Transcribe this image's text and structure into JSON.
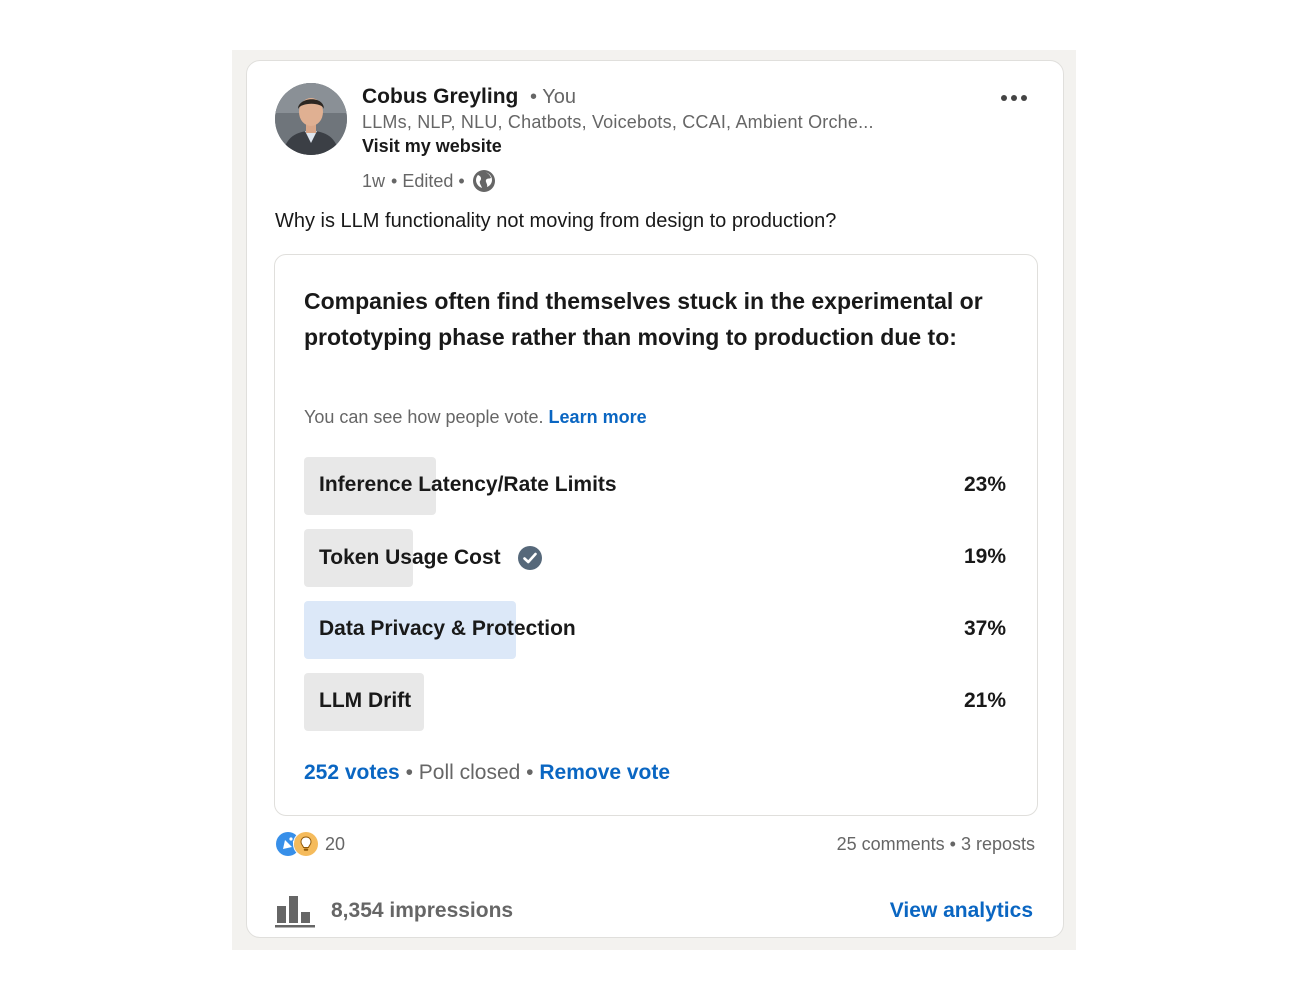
{
  "author": {
    "name": "Cobus Greyling",
    "degree": "• You",
    "headline": "LLMs, NLP, NLU, Chatbots, Voicebots, CCAI, Ambient Orche...",
    "website_label": "Visit my website",
    "time": "1w",
    "edited": "• Edited •",
    "visibility_icon": "globe-icon"
  },
  "menu_icon": "more-horizontal-icon",
  "post": {
    "text": "Why is LLM functionality not moving from design to production?"
  },
  "poll": {
    "question": "Companies often find themselves stuck in the experimental or prototyping phase rather than moving to production due to:",
    "note": "You can see how people vote.",
    "learn_more": "Learn more",
    "options": [
      {
        "label": "Inference Latency/Rate Limits",
        "percent_label": "23%",
        "percent": 23,
        "selected": false
      },
      {
        "label": "Token Usage Cost",
        "percent_label": "19%",
        "percent": 19,
        "selected": false,
        "checked": true
      },
      {
        "label": "Data Privacy & Protection",
        "percent_label": "37%",
        "percent": 37,
        "selected": true
      },
      {
        "label": "LLM Drift",
        "percent_label": "21%",
        "percent": 21,
        "selected": false
      }
    ],
    "votes": "252 votes",
    "status": " • Poll closed • ",
    "remove_vote": "Remove vote"
  },
  "social": {
    "reaction_count": "20",
    "reaction_icons": [
      "celebrate-icon",
      "insightful-icon"
    ],
    "comments": "25 comments",
    "separator": " • ",
    "reposts": "3 reposts"
  },
  "analytics": {
    "impressions": "8,354 impressions",
    "view_analytics": "View analytics",
    "icon": "bar-chart-icon"
  },
  "colors": {
    "link_blue": "#0a66c2",
    "selected_fill": "#dce8f8",
    "option_fill": "#e8e8e8",
    "check_gray": "#56687a"
  }
}
